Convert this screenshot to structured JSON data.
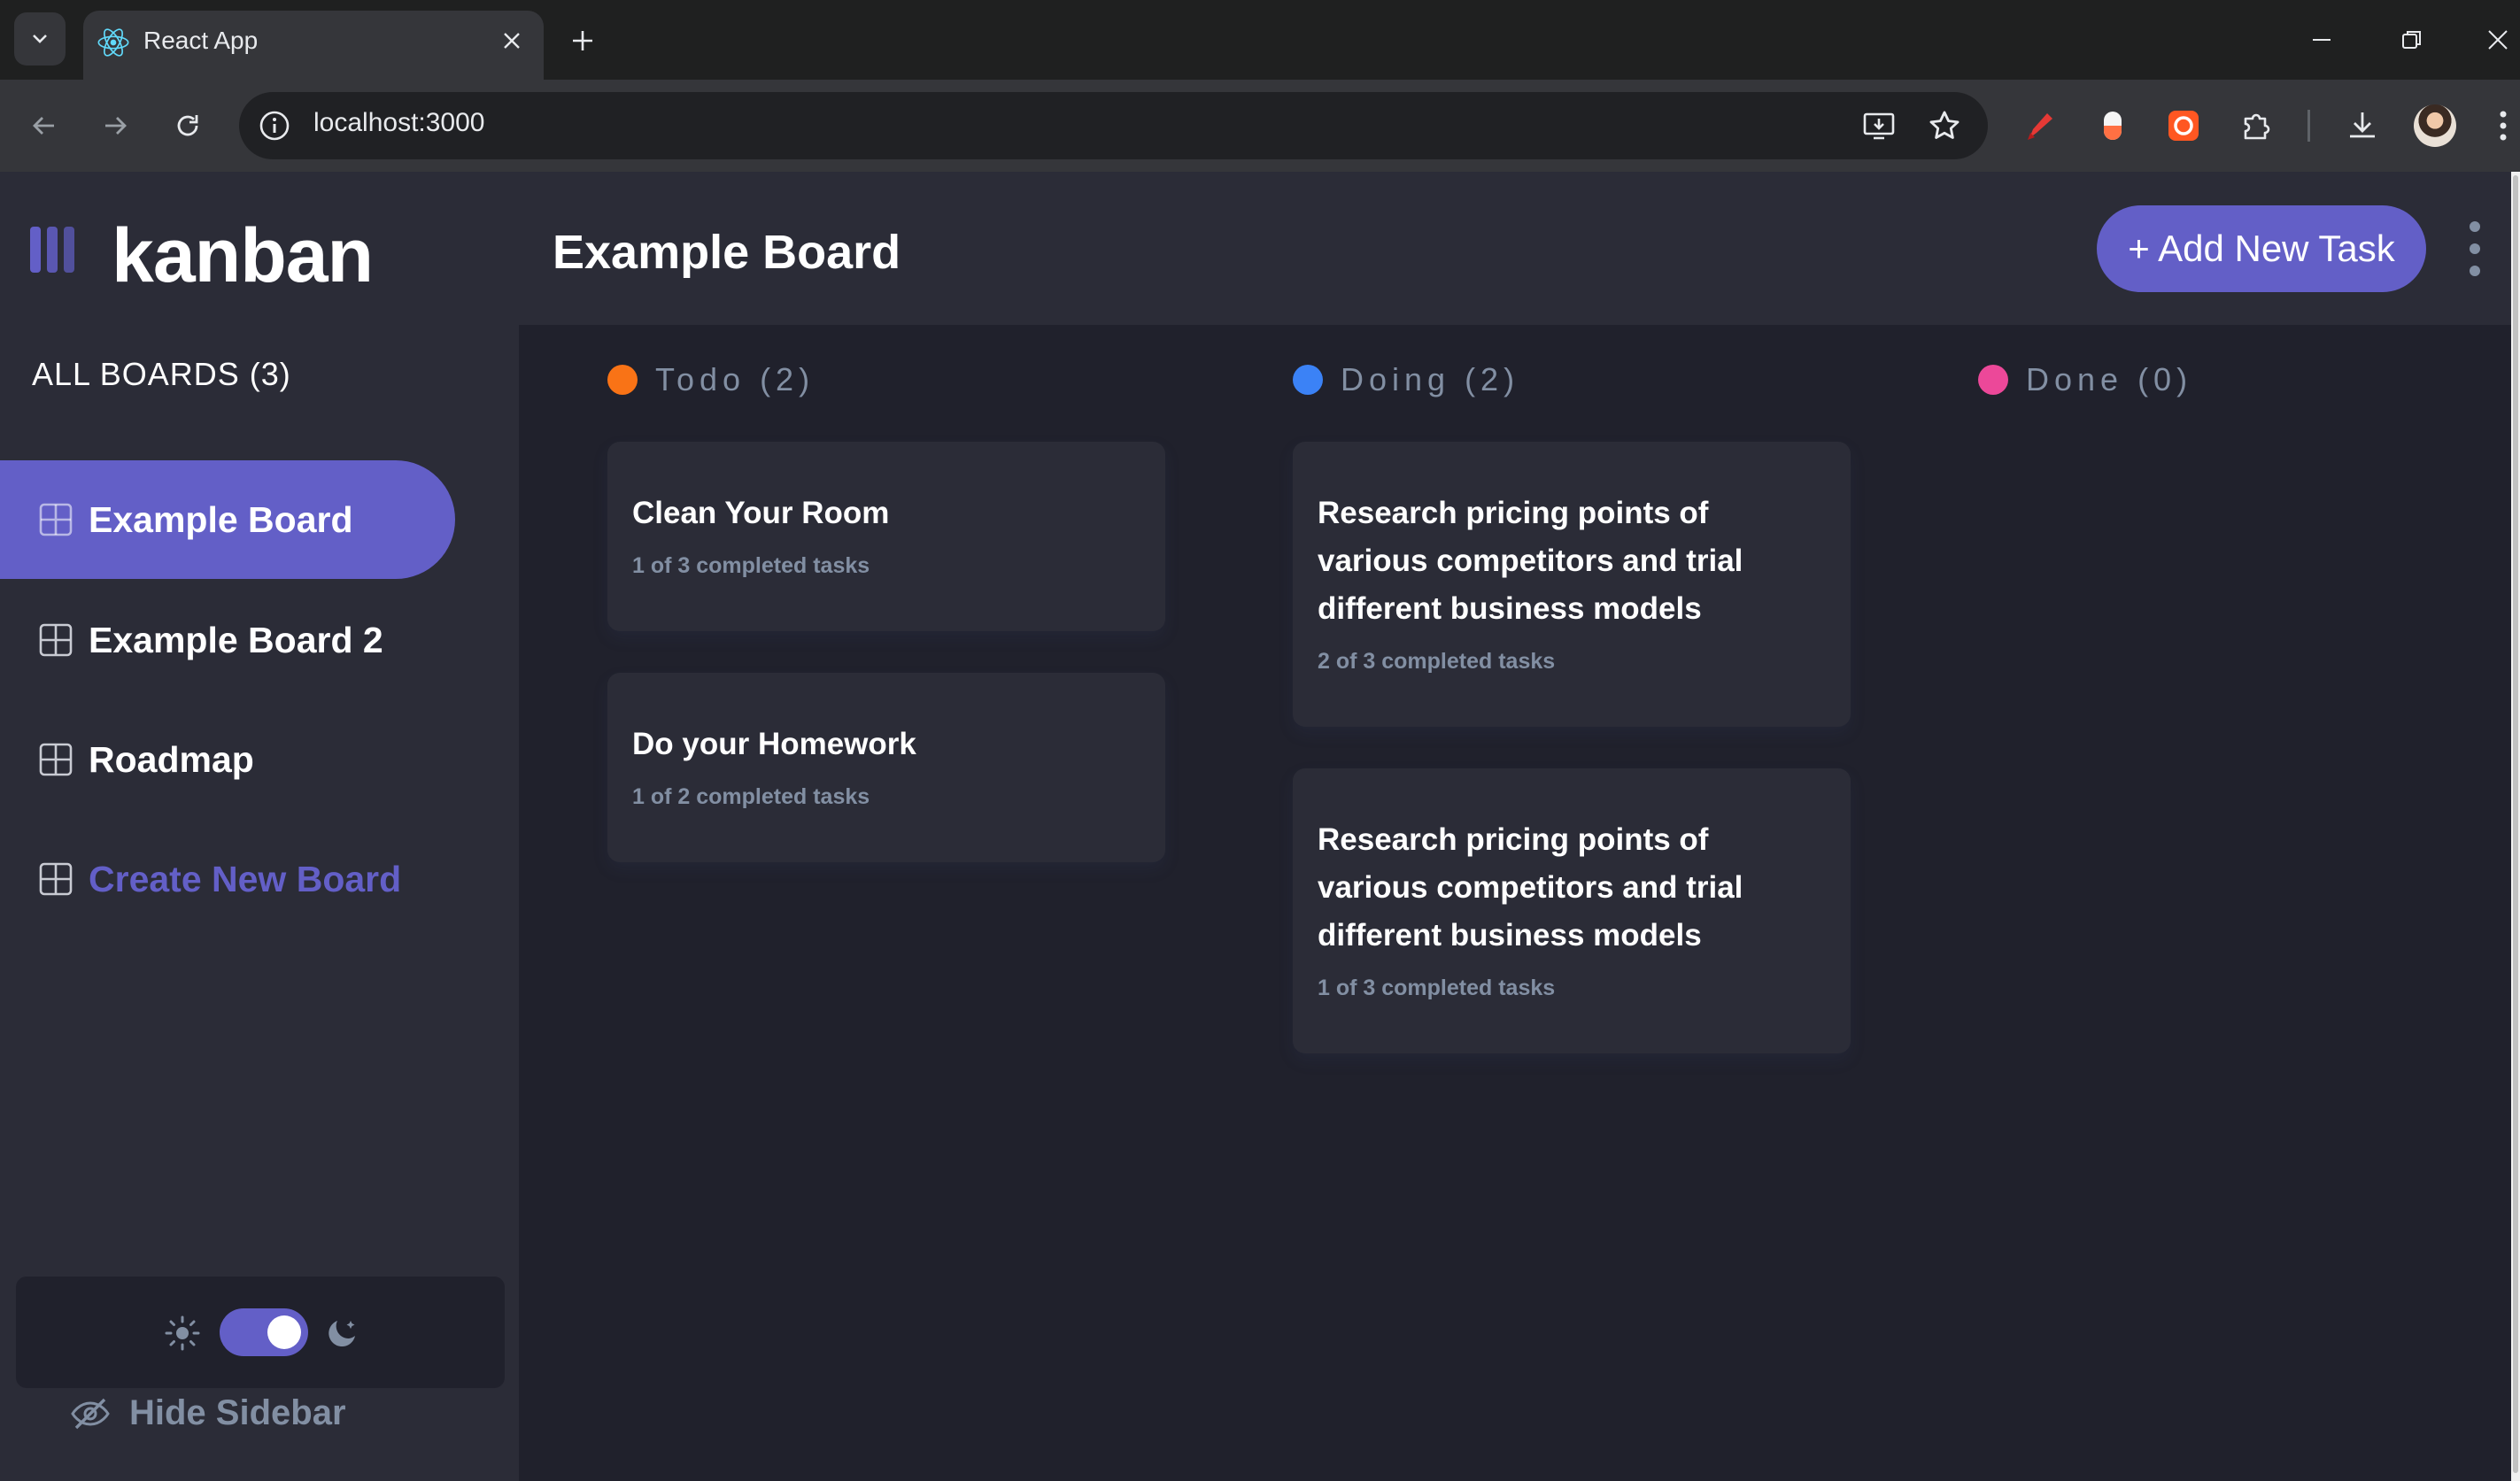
{
  "browser": {
    "tab_title": "React App",
    "url": "localhost:3000"
  },
  "app": {
    "logo_text": "kanban",
    "boards_header": "ALL BOARDS (3)",
    "boards": [
      {
        "label": "Example Board",
        "active": true
      },
      {
        "label": "Example Board 2",
        "active": false
      },
      {
        "label": "Roadmap",
        "active": false
      }
    ],
    "create_board_label": "Create New Board",
    "theme": {
      "mode": "dark"
    },
    "hide_sidebar_label": "Hide Sidebar",
    "accent_color": "#635fc7"
  },
  "header": {
    "board_title": "Example Board",
    "add_task_label": "+ Add New Task"
  },
  "columns": [
    {
      "label": "Todo (2)",
      "dot_color": "#f97316",
      "tasks": [
        {
          "title": "Clean Your Room",
          "subtasks": "1 of 3 completed tasks"
        },
        {
          "title": "Do your Homework",
          "subtasks": "1 of 2 completed tasks"
        }
      ]
    },
    {
      "label": "Doing (2)",
      "dot_color": "#3b82f6",
      "tasks": [
        {
          "title": "Research pricing points of various competitors and trial different business models",
          "subtasks": "2 of 3 completed tasks"
        },
        {
          "title": "Research pricing points of various competitors and trial different business models",
          "subtasks": "1 of 3 completed tasks"
        }
      ]
    },
    {
      "label": "Done (0)",
      "dot_color": "#ec4899",
      "tasks": []
    }
  ]
}
